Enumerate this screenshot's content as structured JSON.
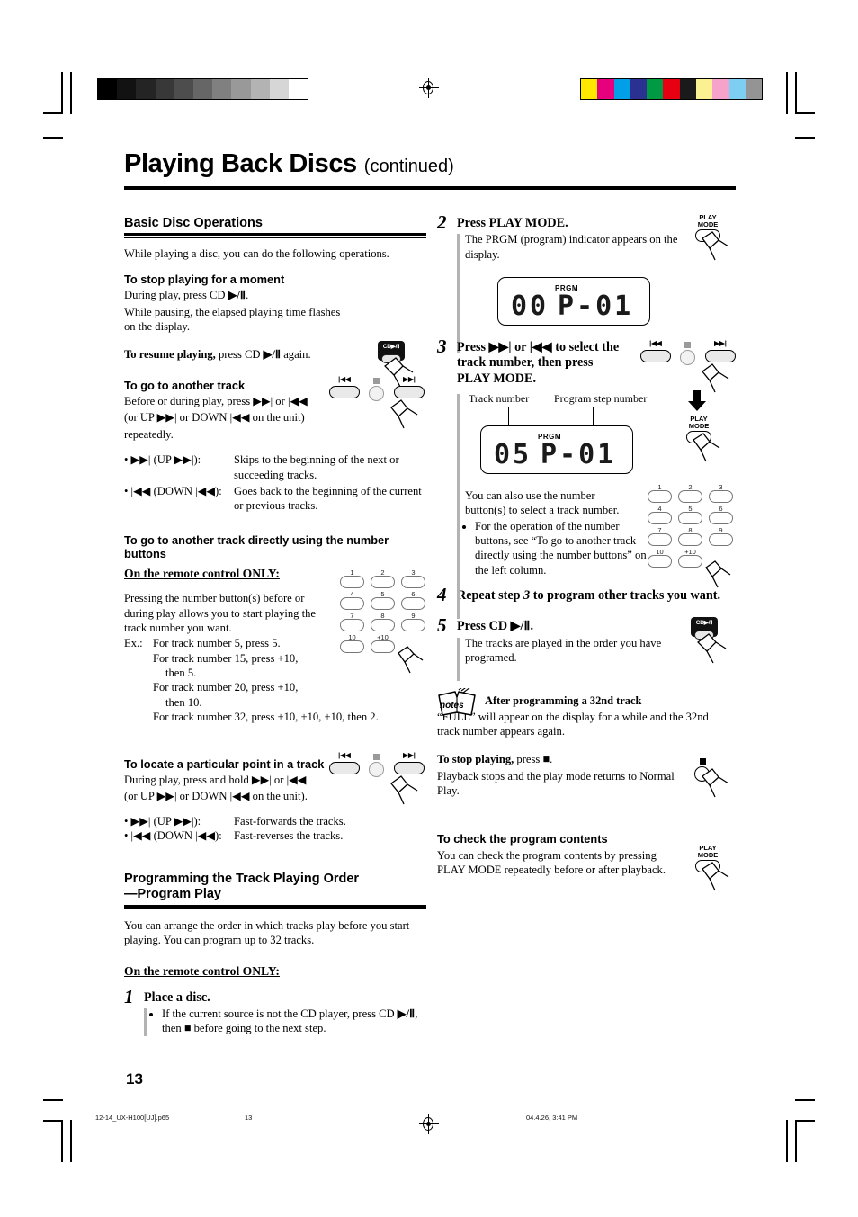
{
  "page": {
    "title_main": "Playing Back Discs",
    "title_suffix": "(continued)",
    "page_number": "13"
  },
  "footer": {
    "file": "12-14_UX-H100[UJ].p65",
    "page": "13",
    "timestamp": "04.4.26, 3:41 PM"
  },
  "printbars": {
    "gray": [
      "#000000",
      "#121212",
      "#242424",
      "#383838",
      "#4d4d4d",
      "#666666",
      "#808080",
      "#999999",
      "#b3b3b3",
      "#d6d6d6",
      "#ffffff"
    ],
    "color": [
      "#ffe800",
      "#e6007e",
      "#00a0e9",
      "#2b3190",
      "#009944",
      "#e60012",
      "#1a1a1a",
      "#fbf193",
      "#f6a3cb",
      "#7ecef4",
      "#949495"
    ]
  },
  "left": {
    "section_title": "Basic Disc Operations",
    "intro": "While playing a disc, you can do the following operations.",
    "stop_moment": {
      "head": "To stop playing for a moment",
      "line1_a": "During play, press CD ",
      "line1_b": "▶/Ⅱ",
      "line1_c": ".",
      "line2": "While pausing, the elapsed playing time flashes on the display.",
      "resume_bold": "To resume playing,",
      "resume_rest_a": " press CD ",
      "resume_rest_b": "▶/Ⅱ",
      "resume_rest_c": " again.",
      "button_label": "CD▶/Ⅱ"
    },
    "another_track": {
      "head": "To go to another track",
      "line1": "Before or during play, press ▶▶| or |◀◀",
      "line2": "(or UP ▶▶| or DOWN |◀◀ on the unit)",
      "line3": "repeatedly.",
      "defs": [
        {
          "key": "• ▶▶|  (UP ▶▶|):",
          "value": "Skips to the beginning of the next or succeeding tracks."
        },
        {
          "key": "• |◀◀  (DOWN |◀◀):",
          "value": "Goes back to the beginning of the current or previous tracks."
        }
      ],
      "icon_left": "|◀◀",
      "icon_right": "▶▶|"
    },
    "number_buttons": {
      "head": "To go to another track directly using the number buttons",
      "remote_only": "On the remote control ONLY:",
      "para": "Pressing the number button(s) before or during play allows you to start playing the track number you want.",
      "ex_label": "Ex.:",
      "examples": [
        "For track number 5, press 5.",
        "For track number 15, press +10,",
        "then 5.",
        "For track number 20, press +10,",
        "then 10.",
        "For track number 32, press +10, +10, +10, then 2."
      ],
      "keys": [
        "1",
        "2",
        "3",
        "4",
        "5",
        "6",
        "7",
        "8",
        "9",
        "10",
        "+10"
      ]
    },
    "locate_point": {
      "head": "To locate a particular point in a track",
      "line1": "During play, press and hold ▶▶| or |◀◀",
      "line2": "(or UP ▶▶| or DOWN |◀◀ on the unit).",
      "defs": [
        {
          "key": "• ▶▶|  (UP ▶▶|):",
          "value": "Fast-forwards the tracks."
        },
        {
          "key": "• |◀◀ (DOWN |◀◀):",
          "value": "Fast-reverses the tracks."
        }
      ]
    },
    "program": {
      "head_line1": "Programming the Track Playing Order",
      "head_line2": "—Program Play",
      "para": "You can arrange the order in which tracks play before you start playing. You can program up to 32 tracks.",
      "remote_only": "On the remote control ONLY:",
      "step1": {
        "num": "1",
        "head": "Place a disc.",
        "bullet_a": "If the current source is not the CD player, press CD ",
        "bullet_b": "▶/Ⅱ",
        "bullet_c": ", then ■ before going to the next step."
      }
    }
  },
  "right": {
    "step2": {
      "num": "2",
      "head": "Press PLAY MODE.",
      "body": "The PRGM (program) indicator appears  on the display.",
      "button_label_1": "PLAY",
      "button_label_2": "MODE",
      "lcd": {
        "left": "00",
        "prgm": "PRGM",
        "right": "P-01"
      }
    },
    "step3": {
      "num": "3",
      "head_line1": "Press ▶▶| or |◀◀ to select the",
      "head_line2": "track number, then press",
      "head_line3": "PLAY MODE.",
      "callout_track": "Track number",
      "callout_step": "Program step number",
      "lcd": {
        "left": "05",
        "prgm": "PRGM",
        "right": "P-01"
      },
      "body": "You can also use the number button(s) to select a track number.",
      "bullet": "For the operation of the number buttons, see “To go to another track directly using the number buttons” on the left column.",
      "icon_left": "|◀◀",
      "icon_right": "▶▶|",
      "button_label_1": "PLAY",
      "button_label_2": "MODE",
      "keys": [
        "1",
        "2",
        "3",
        "4",
        "5",
        "6",
        "7",
        "8",
        "9",
        "10",
        "+10"
      ]
    },
    "step4": {
      "num": "4",
      "head_a": "Repeat step ",
      "head_num": "3",
      "head_b": " to program other tracks you want."
    },
    "step5": {
      "num": "5",
      "head_a": "Press CD ",
      "head_b": "▶/Ⅱ",
      "head_c": ".",
      "body": "The tracks are played in the order you have programed.",
      "button_label": "CD▶/Ⅱ"
    },
    "notes": {
      "icon_word": "notes",
      "head": "After programming a 32nd track",
      "body": "“FULL” will appear on the display for a while and the 32nd track number appears again.",
      "stop_bold": "To stop playing,",
      "stop_rest": " press ■.",
      "stop_body": "Playback stops and the play mode returns to Normal Play."
    },
    "check": {
      "head": "To check the program contents",
      "body": "You can check the program contents by pressing PLAY MODE repeatedly before or after playback.",
      "button_label_1": "PLAY",
      "button_label_2": "MODE"
    }
  }
}
